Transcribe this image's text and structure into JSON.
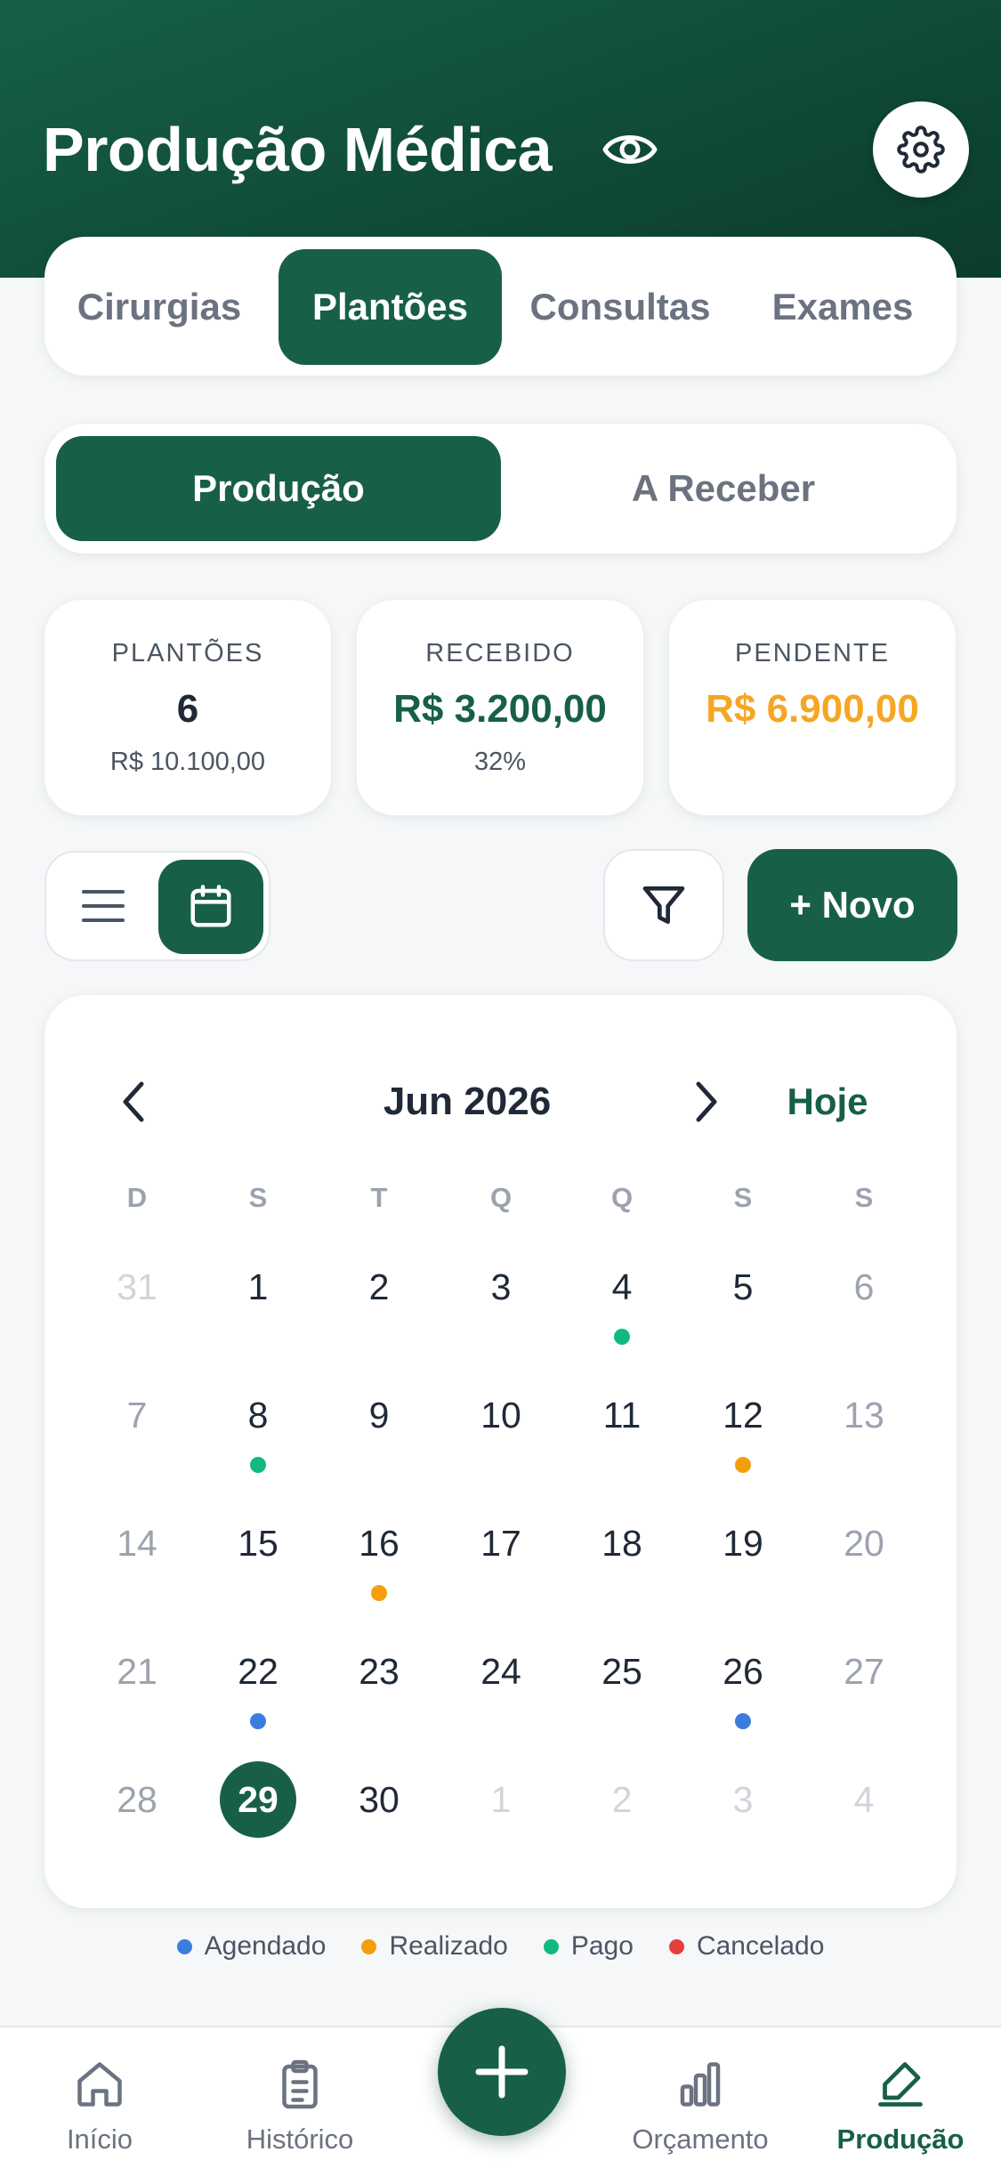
{
  "header": {
    "title": "Produção Médica"
  },
  "tabs": [
    {
      "label": "Cirurgias",
      "active": false
    },
    {
      "label": "Plantões",
      "active": true
    },
    {
      "label": "Consultas",
      "active": false
    },
    {
      "label": "Exames",
      "active": false
    }
  ],
  "segment": [
    {
      "label": "Produção",
      "active": true
    },
    {
      "label": "A Receber",
      "active": false
    }
  ],
  "stats": {
    "plantoes": {
      "label": "PLANTÕES",
      "value": "6",
      "sub": "R$ 10.100,00"
    },
    "recebido": {
      "label": "RECEBIDO",
      "value": "R$ 3.200,00",
      "sub": "32%"
    },
    "pendente": {
      "label": "PENDENTE",
      "value": "R$ 6.900,00"
    }
  },
  "actions": {
    "new_label": "+ Novo",
    "view": "calendar"
  },
  "calendar": {
    "month_label": "Jun 2026",
    "today_label": "Hoje",
    "weekdays": [
      "D",
      "S",
      "T",
      "Q",
      "Q",
      "S",
      "S"
    ],
    "weeks": [
      [
        {
          "d": "31",
          "o": true
        },
        {
          "d": "1"
        },
        {
          "d": "2"
        },
        {
          "d": "3"
        },
        {
          "d": "4",
          "s": "pago"
        },
        {
          "d": "5"
        },
        {
          "d": "6"
        }
      ],
      [
        {
          "d": "7"
        },
        {
          "d": "8",
          "s": "pago"
        },
        {
          "d": "9"
        },
        {
          "d": "10"
        },
        {
          "d": "11"
        },
        {
          "d": "12",
          "s": "realizado"
        },
        {
          "d": "13"
        }
      ],
      [
        {
          "d": "14"
        },
        {
          "d": "15"
        },
        {
          "d": "16",
          "s": "realizado"
        },
        {
          "d": "17"
        },
        {
          "d": "18"
        },
        {
          "d": "19"
        },
        {
          "d": "20"
        }
      ],
      [
        {
          "d": "21"
        },
        {
          "d": "22",
          "s": "agendado"
        },
        {
          "d": "23"
        },
        {
          "d": "24"
        },
        {
          "d": "25"
        },
        {
          "d": "26",
          "s": "agendado"
        },
        {
          "d": "27"
        }
      ],
      [
        {
          "d": "28"
        },
        {
          "d": "29",
          "today": true
        },
        {
          "d": "30"
        },
        {
          "d": "1",
          "o": true
        },
        {
          "d": "2",
          "o": true
        },
        {
          "d": "3",
          "o": true
        },
        {
          "d": "4",
          "o": true
        }
      ]
    ]
  },
  "legend": [
    {
      "key": "agendado",
      "label": "Agendado",
      "color": "#3b7ddd"
    },
    {
      "key": "realizado",
      "label": "Realizado",
      "color": "#f59e0b"
    },
    {
      "key": "pago",
      "label": "Pago",
      "color": "#10b981"
    },
    {
      "key": "cancelado",
      "label": "Cancelado",
      "color": "#e53e3e"
    }
  ],
  "colors": {
    "primary": "#176046",
    "received": "#176046",
    "pending": "#f5a623"
  },
  "bottom_nav": [
    {
      "label": "Início",
      "icon": "home-icon"
    },
    {
      "label": "Histórico",
      "icon": "clipboard-icon"
    },
    {
      "label": "Orçamento",
      "icon": "bar-chart-icon"
    },
    {
      "label": "Produção",
      "icon": "pen-icon",
      "active": true
    }
  ]
}
